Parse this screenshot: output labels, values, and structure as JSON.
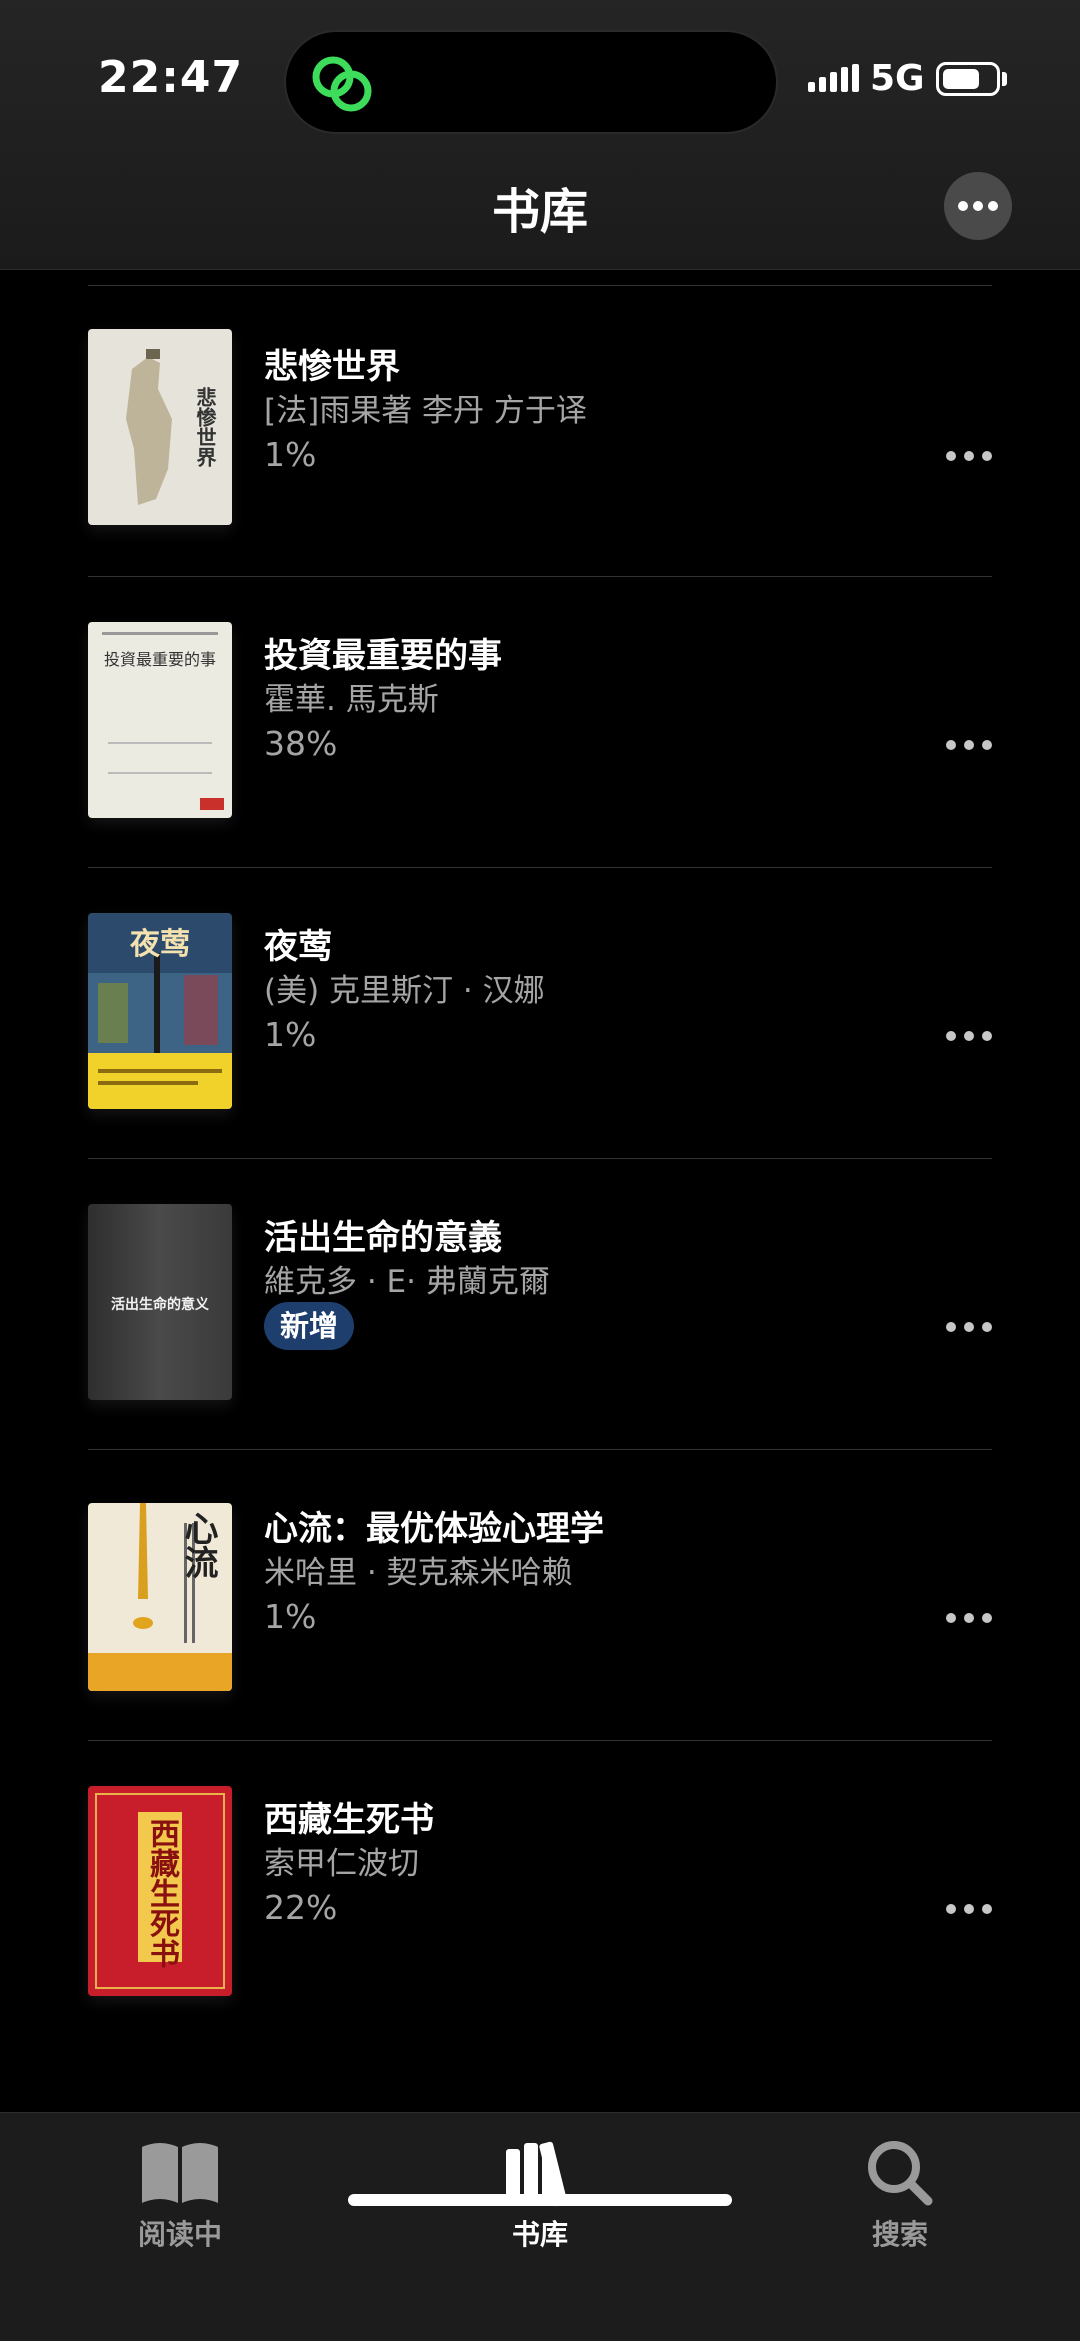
{
  "status_bar": {
    "time": "22:47",
    "network": "5G",
    "app_icon": "link-rings-icon",
    "accent_color": "#3ddc5a"
  },
  "header": {
    "title": "书库",
    "more_icon": "ellipsis-icon"
  },
  "books": [
    {
      "title": "悲惨世界",
      "author": "[法]雨果著 李丹 方于译",
      "progress": "1%",
      "cover_color": "#e6e3da",
      "cover_text": "悲惨世界"
    },
    {
      "title": "投資最重要的事",
      "author": "霍華. 馬克斯",
      "progress": "38%",
      "cover_color": "#ecebe2",
      "cover_text": "投資最重要的事"
    },
    {
      "title": "夜莺",
      "author": "(美) 克里斯汀 · 汉娜",
      "progress": "1%",
      "cover_color": "#2c4a6b",
      "cover_text": "夜莺"
    },
    {
      "title": "活出生命的意義",
      "author": "維克多 · E· 弗蘭克爾",
      "badge": "新增",
      "cover_color": "#3a3a3a",
      "cover_text": "活出生命的意义"
    },
    {
      "title": "心流：最优体验心理学",
      "author": "米哈里 · 契克森米哈赖",
      "progress": "1%",
      "cover_color": "#f1e9d8",
      "cover_text": "心流"
    },
    {
      "title": "西藏生死书",
      "author": "索甲仁波切",
      "progress": "22%",
      "cover_color": "#c81d2a",
      "cover_text": "西藏生死书"
    }
  ],
  "tabbar": {
    "tabs": [
      {
        "label": "阅读中",
        "icon": "open-book-icon",
        "active": false
      },
      {
        "label": "书库",
        "icon": "library-books-icon",
        "active": true
      },
      {
        "label": "搜索",
        "icon": "search-icon",
        "active": false
      }
    ]
  }
}
